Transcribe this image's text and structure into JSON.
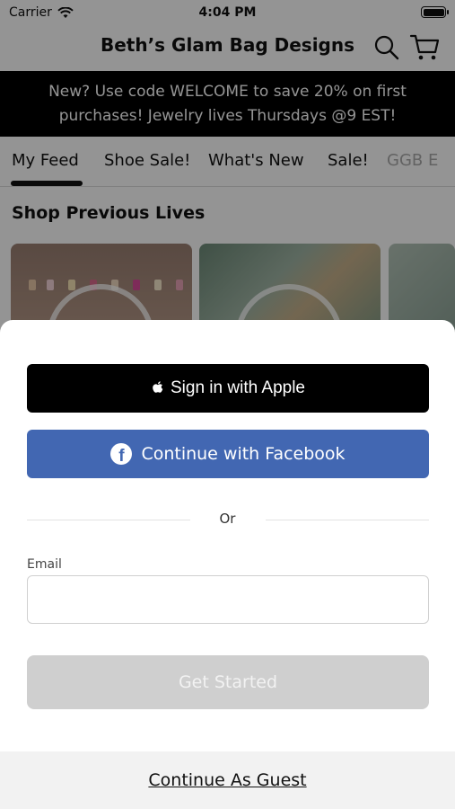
{
  "status_bar": {
    "carrier": "Carrier",
    "time": "4:04 PM"
  },
  "header": {
    "title": "Beth’s Glam Bag Designs",
    "search_icon": "search-icon",
    "cart_icon": "cart-icon"
  },
  "banner": {
    "line1": "New? Use code WELCOME to save 20% on first",
    "line2": "purchases! Jewelry lives Thursdays @9 EST!"
  },
  "tabs": [
    {
      "label": "My Feed",
      "active": true
    },
    {
      "label": "Shoe Sale!"
    },
    {
      "label": "What's New"
    },
    {
      "label": "Sale!"
    },
    {
      "label": "GGB E"
    }
  ],
  "section": {
    "title": "Shop Previous Lives"
  },
  "sheet": {
    "apple_label": "Sign in with Apple",
    "facebook_label": "Continue with Facebook",
    "or_text": "Or",
    "email_label": "Email",
    "email_value": "",
    "email_placeholder": "",
    "get_started_label": "Get Started",
    "guest_label": "Continue As Guest"
  },
  "colors": {
    "facebook": "#4267b2",
    "apple": "#000000",
    "disabled_button": "#cfcfcf"
  }
}
